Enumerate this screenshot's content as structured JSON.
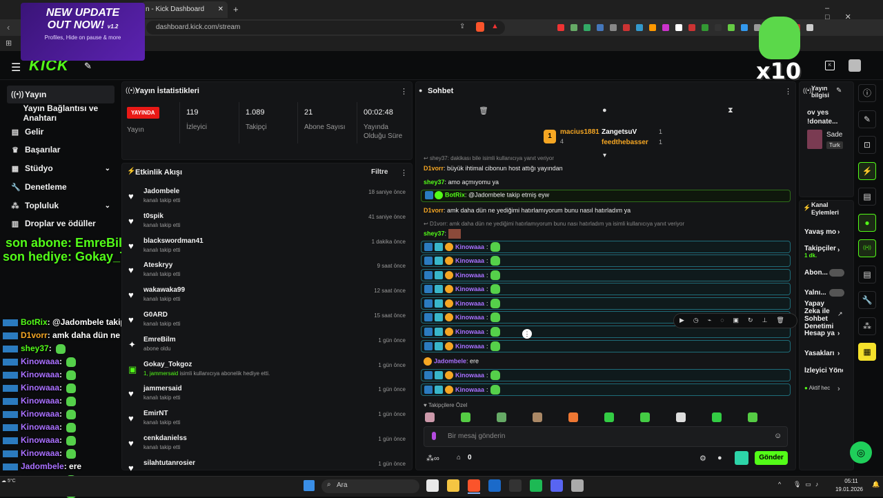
{
  "browser": {
    "tab_title": "n - Kick Dashboard",
    "url": "dashboard.kick.com/stream",
    "new_tab": "+"
  },
  "banner": {
    "line1": "NEW UPDATE",
    "line2": "OUT NOW!",
    "version": "v1.2",
    "sub": "Profiles, Hide on pause & more"
  },
  "overlay": {
    "multiplier": "x10",
    "last_sub": "son abone: EmreBilm",
    "last_gift": "son hediye: Gokay_Tokgoz",
    "chat": [
      {
        "name": "BotRix",
        "text": ": @Jadombele takip etmiş eyw",
        "color": "#53fc18"
      },
      {
        "name": "D1vorr",
        "text": ": amk daha dün ne yediğimi hatırlamıyorum bunu nası hatırladım ya",
        "color": "#f5a623"
      },
      {
        "name": "shey37",
        "text": ":",
        "color": "#53fc18"
      },
      {
        "name": "Kinowaaa",
        "text": ":",
        "color": "#a970ff"
      },
      {
        "name": "Kinowaaa",
        "text": ":",
        "color": "#a970ff"
      },
      {
        "name": "Kinowaaa",
        "text": ":",
        "color": "#a970ff"
      },
      {
        "name": "Kinowaaa",
        "text": ":",
        "color": "#a970ff"
      },
      {
        "name": "Kinowaaa",
        "text": ":",
        "color": "#a970ff"
      },
      {
        "name": "Kinowaaa",
        "text": ":",
        "color": "#a970ff"
      },
      {
        "name": "Kinowaaa",
        "text": ":",
        "color": "#a970ff"
      },
      {
        "name": "Kinowaaa",
        "text": ":",
        "color": "#a970ff"
      },
      {
        "name": "Jadombele",
        "text": ": ere",
        "color": "#a970ff"
      },
      {
        "name": "Kinowaaa",
        "text": ":",
        "color": "#a970ff"
      },
      {
        "name": "Kinowaaa",
        "text": ":",
        "color": "#a970ff"
      }
    ]
  },
  "nav": {
    "items": [
      {
        "label": "Yayın",
        "icon": "broadcast-icon"
      },
      {
        "label": "Yayın Bağlantısı ve Anahtarı",
        "icon": ""
      },
      {
        "label": "Gelir",
        "icon": "money-icon"
      },
      {
        "label": "Başarılar",
        "icon": "trophy-icon"
      },
      {
        "label": "Stüdyo",
        "icon": "studio-icon"
      },
      {
        "label": "Denetleme",
        "icon": "wrench-icon"
      },
      {
        "label": "Topluluk",
        "icon": "community-icon"
      },
      {
        "label": "Droplar ve ödüller",
        "icon": "gift-icon"
      }
    ]
  },
  "stats": {
    "title": "Yayın İstatistikleri",
    "live_badge": "YAYINDA",
    "live_label": "Yayın",
    "viewers": "119",
    "viewers_label": "İzleyici",
    "followers": "1.089",
    "followers_label": "Takipçi",
    "subs": "21",
    "subs_label": "Abone Sayısı",
    "uptime": "00:02:48",
    "uptime_label": "Yayında Olduğu Süre"
  },
  "activity": {
    "title": "Etkinlik Akışı",
    "filter": "Filtre",
    "items": [
      {
        "name": "Jadombele",
        "sub": "kanalı takip etti",
        "time": "18 saniye önce",
        "type": "follow"
      },
      {
        "name": "t0spik",
        "sub": "kanalı takip etti",
        "time": "41 saniye önce",
        "type": "follow"
      },
      {
        "name": "blackswordman41",
        "sub": "kanalı takip etti",
        "time": "1 dakika önce",
        "type": "follow"
      },
      {
        "name": "Ateskryy",
        "sub": "kanalı takip etti",
        "time": "9 saat önce",
        "type": "follow"
      },
      {
        "name": "wakawaka99",
        "sub": "kanalı takip etti",
        "time": "12 saat önce",
        "type": "follow"
      },
      {
        "name": "G0ARD",
        "sub": "kanalı takip etti",
        "time": "15 saat önce",
        "type": "follow"
      },
      {
        "name": "EmreBilm",
        "sub": "abone oldu",
        "time": "1 gün önce",
        "type": "sub"
      },
      {
        "name": "Gokay_Tokgoz",
        "sub_hl": "1, jammersaid",
        "sub": " isimli kullanıcıya abonelik hediye etti.",
        "time": "1 gün önce",
        "type": "gift"
      },
      {
        "name": "jammersaid",
        "sub": "kanalı takip etti",
        "time": "1 gün önce",
        "type": "follow"
      },
      {
        "name": "EmirNT",
        "sub": "kanalı takip etti",
        "time": "1 gün önce",
        "type": "follow"
      },
      {
        "name": "cenkdanielss",
        "sub": "kanalı takip etti",
        "time": "1 gün önce",
        "type": "follow"
      },
      {
        "name": "silahtutanrosier",
        "sub": "",
        "time": "1 gün önce",
        "type": "follow"
      }
    ]
  },
  "chat": {
    "title": "Sohbet",
    "leaders": {
      "first": "macius1881",
      "first_count": "4",
      "second": "ZangetsuV",
      "second_count": "1",
      "third": "feedthebasser",
      "third_count": "1"
    },
    "lines": [
      {
        "reply": "shey37: dakikası bile isimli kullanıcıya yanıt veriyor"
      },
      {
        "name": "D1vorr",
        "text": ": büyük ihtimal cibonun host attığı yayından",
        "color": "#f5a623"
      },
      {
        "name": "shey37",
        "text": ": amo açmıyomu ya",
        "color": "#53fc18"
      },
      {
        "name": "BotRix",
        "text": ": @Jadombele takip etmiş eyw",
        "color": "#53fc18"
      },
      {
        "name": "D1vorr",
        "text": ": amk daha dün ne yediğimi hatırlamıyorum bunu nasıl hatırladım ya",
        "color": "#f5a623"
      },
      {
        "reply": "D1vorr: amk daha dün ne yediğimi hatırlamıyorum bunu nası hatırladım ya isimli kullanıcıya yanıt veriyor"
      },
      {
        "name": "shey37",
        "text": ":",
        "color": "#53fc18"
      }
    ],
    "kino_name": "Kinowaaa",
    "jadombele_name": "Jadombele",
    "jadombele_text": ": ere",
    "followers_only": "Takipçilere Özel",
    "input_placeholder": "Bir mesaj gönderin",
    "points": "0",
    "send_label": "Gönder"
  },
  "right": {
    "info_title": "Yayın bilgisi",
    "info_text1": "ov yes",
    "info_text2": "!donate...",
    "info_name": "Sade",
    "info_tag": "Turk",
    "actions_title": "Kanal Eylemleri",
    "slow": "Yavaş mo",
    "followers": "Takipçiler",
    "followers_sub": "1 dk.",
    "subs": "Abon...",
    "emote": "Yalnı...",
    "ai": "Yapay Zeka ile Sohbet Denetimi",
    "account": "Hesap ya",
    "bans": "Yasakları",
    "viewer": "İzleyici Yöneti",
    "active": "Aktif hec"
  },
  "taskbar": {
    "search": "Ara",
    "time": "05:11",
    "date": "19.01.2026"
  },
  "colors": {
    "accent": "#53fc18",
    "kino": "#a970ff",
    "live": "#e91916"
  }
}
